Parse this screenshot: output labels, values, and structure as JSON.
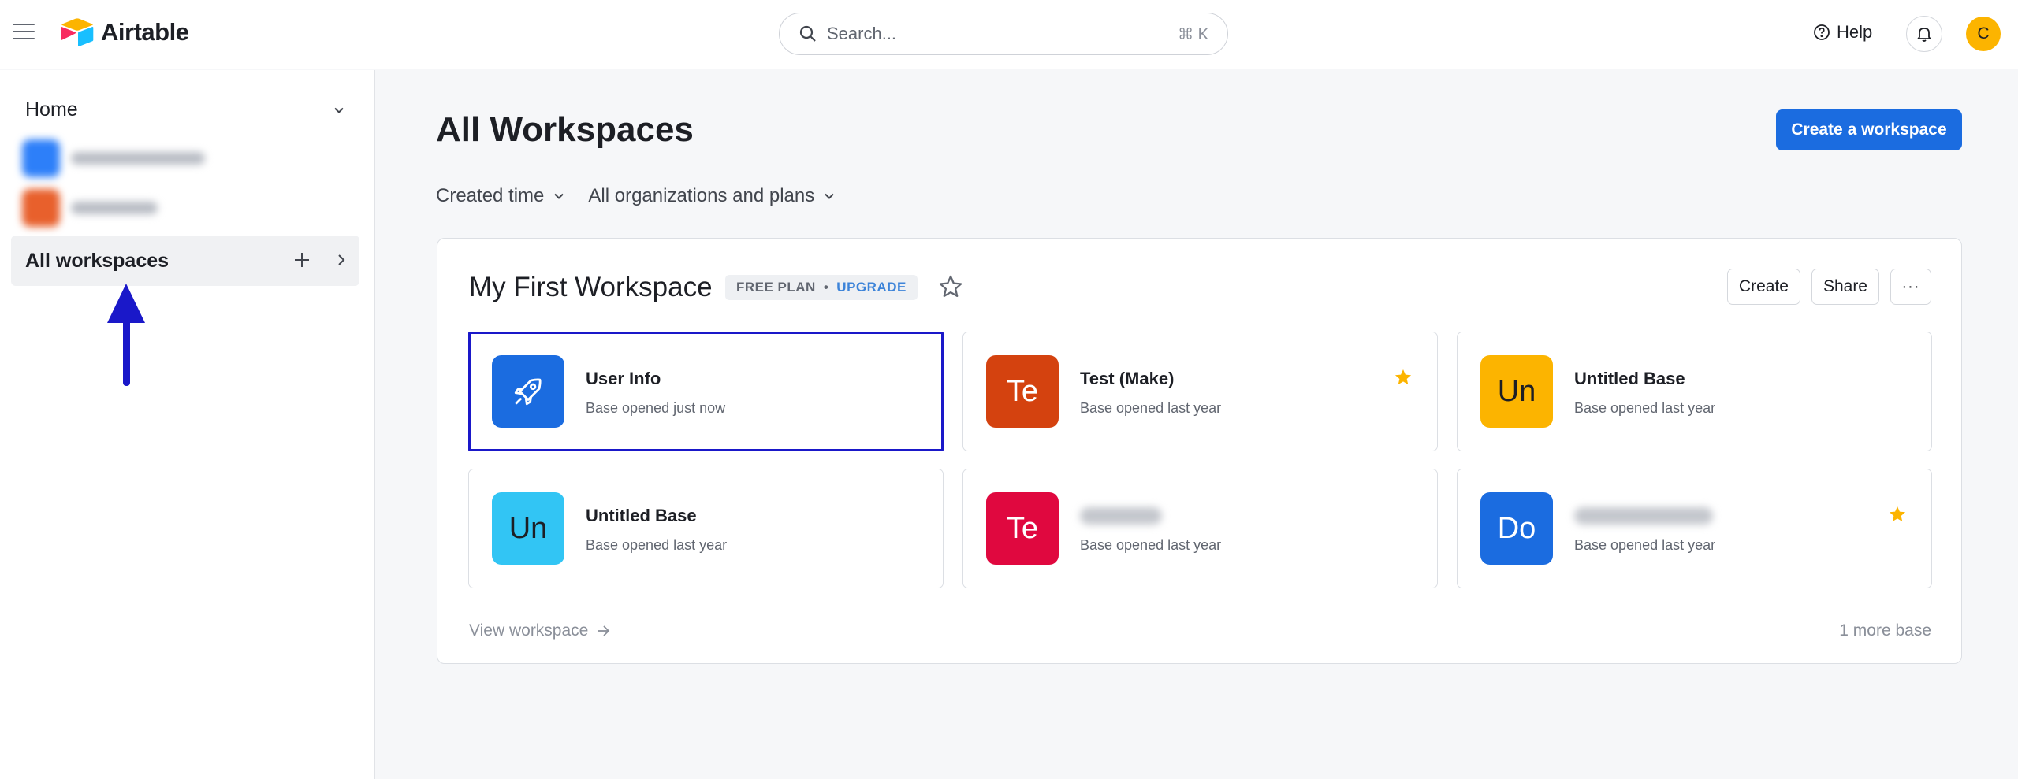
{
  "app": {
    "name": "Airtable"
  },
  "search": {
    "placeholder": "Search...",
    "shortcut": "⌘ K"
  },
  "header": {
    "help_label": "Help",
    "avatar_initial": "C"
  },
  "sidebar": {
    "home_label": "Home",
    "all_workspaces_label": "All workspaces"
  },
  "main": {
    "title": "All Workspaces",
    "create_workspace_label": "Create a workspace",
    "filters": {
      "sort": "Created time",
      "orgs": "All organizations and plans"
    }
  },
  "workspace": {
    "name": "My First Workspace",
    "plan": "FREE PLAN",
    "plan_separator": "•",
    "upgrade": "UPGRADE",
    "actions": {
      "create": "Create",
      "share": "Share",
      "more": "···"
    },
    "view_label": "View workspace",
    "more_bases": "1 more base",
    "bases": [
      {
        "initials": "",
        "name": "User Info",
        "subtitle": "Base opened just now",
        "color": "#1b6ce0",
        "icon": "rocket-icon",
        "starred": false,
        "selected": true
      },
      {
        "initials": "Te",
        "name": "Test (Make)",
        "subtitle": "Base opened last year",
        "color": "#d4420f",
        "starred": true,
        "selected": false
      },
      {
        "initials": "Un",
        "name": "Untitled Base",
        "subtitle": "Base opened last year",
        "color": "#fcb400",
        "starred": false,
        "selected": false
      },
      {
        "initials": "Un",
        "name": "Untitled Base",
        "subtitle": "Base opened last year",
        "color": "#32c5f4",
        "starred": false,
        "selected": false
      },
      {
        "initials": "Te",
        "name": "",
        "subtitle": "Base opened last year",
        "color": "#e0083f",
        "starred": false,
        "selected": false
      },
      {
        "initials": "Do",
        "name": "",
        "subtitle": "Base opened last year",
        "color": "#1b6ce0",
        "starred": true,
        "selected": false
      }
    ]
  },
  "colors": {
    "accent": "#1b6ce0",
    "highlight": "#1a18c9",
    "star": "#fcb400"
  }
}
